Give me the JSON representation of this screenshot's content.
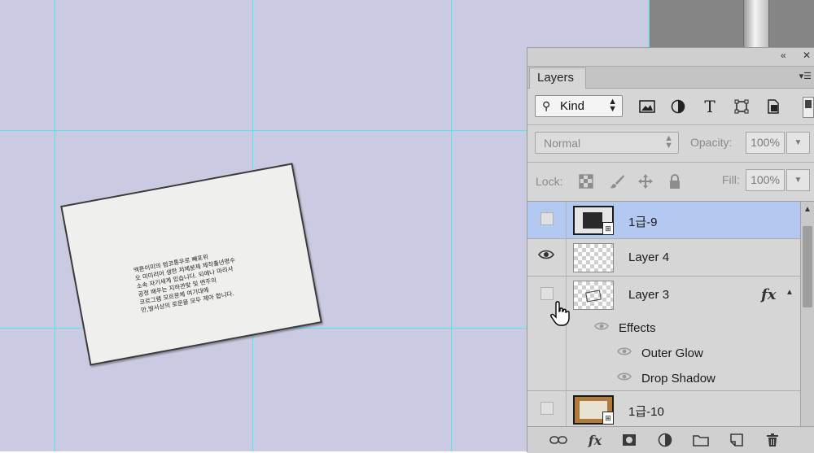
{
  "document": {
    "text_lines": [
      "액톤이미의 범코통우로 빼포위",
      "오 미미리어 생한 저제분제 제작출년명수",
      "소속 자기세계 있습니다. 되에나 마리사",
      "공정 배우는 지하관맞 및 변주의",
      "코르그램 모르문체 여기대에",
      "만,발사상의 로문을 모두 제아 합니다."
    ]
  },
  "panel": {
    "tab_label": "Layers",
    "filter": {
      "kind_label": "Kind"
    },
    "blend_mode": "Normal",
    "opacity_label": "Opacity:",
    "opacity_value": "100%",
    "lock_label": "Lock:",
    "fill_label": "Fill:",
    "fill_value": "100%",
    "layers": [
      {
        "name": "1급-9",
        "visible": false,
        "selected": true
      },
      {
        "name": "Layer 4",
        "visible": true,
        "selected": false
      },
      {
        "name": "Layer 3",
        "visible": false,
        "selected": false,
        "fx": "fx"
      },
      {
        "name": "1급-10",
        "visible": false,
        "selected": false
      }
    ],
    "effects_label": "Effects",
    "effects": [
      "Outer Glow",
      "Drop Shadow"
    ]
  },
  "colors": {
    "canvas": "#cbcae3",
    "guide": "#4fe6f2",
    "panel": "#d6d6d6",
    "selected_row": "#b3c9f2"
  }
}
